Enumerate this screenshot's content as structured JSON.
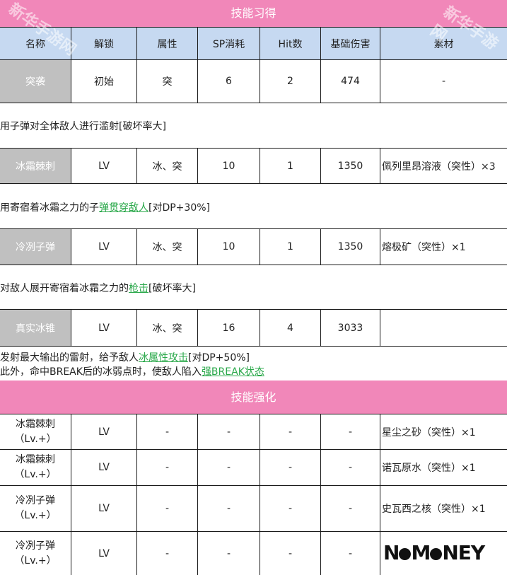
{
  "section1_title": "技能习得",
  "section2_title": "技能强化",
  "headers": [
    "名称",
    "解锁",
    "属性",
    "SP消耗",
    "Hit数",
    "基础伤害",
    "素材"
  ],
  "skills": [
    {
      "name": "突袭",
      "unlock": "初始",
      "attr": "突",
      "sp": "6",
      "hit": "2",
      "dmg": "474",
      "mat": "-"
    },
    {
      "name": "冰霜棘刺",
      "unlock": "LV",
      "attr": "冰、突",
      "sp": "10",
      "hit": "1",
      "dmg": "1350",
      "mat": "佩列里昂溶液（突性）×3"
    },
    {
      "name": "冷冽子弹",
      "unlock": "LV",
      "attr": "冰、突",
      "sp": "10",
      "hit": "1",
      "dmg": "1350",
      "mat": "熔极矿（突性）×1"
    },
    {
      "name": "真实冰锥",
      "unlock": "LV",
      "attr": "冰、突",
      "sp": "16",
      "hit": "4",
      "dmg": "3033",
      "mat": ""
    }
  ],
  "descriptions": {
    "d1": "用子弹对全体敌人进行滥射[破坏率大]",
    "d2_pre": "用寄宿着冰霜之力的子",
    "d2_link": "弹贯穿敌人",
    "d2_post": "[对DP+30%]",
    "d3_pre": "对敌人展开寄宿着冰霜之力的",
    "d3_link": "枪击",
    "d3_post": "[破坏率大]",
    "d4a_pre": "发射最大输出的雷射，给予敌人",
    "d4a_link": "冰属性攻击",
    "d4a_post": "[对DP+50%]",
    "d4b_pre": "此外，命中BREAK后的冰弱点时，使敌人陷入",
    "d4b_link": "强BREAK状态"
  },
  "upgrades": [
    {
      "name": "冰霜棘刺",
      "lv": "（Lv.+）",
      "unlock": "LV",
      "a": "-",
      "b": "-",
      "c": "-",
      "d": "-",
      "mat": "星尘之砂（突性）×1"
    },
    {
      "name": "冰霜棘刺",
      "lv": "（Lv.+）",
      "unlock": "LV",
      "a": "-",
      "b": "-",
      "c": "-",
      "d": "-",
      "mat": "诺瓦原水（突性）×1"
    },
    {
      "name": "冷冽子弹",
      "lv": "（Lv.+）",
      "unlock": "LV",
      "a": "-",
      "b": "-",
      "c": "-",
      "d": "-",
      "mat": "史瓦西之核（突性）×1"
    },
    {
      "name": "冷冽子弹",
      "lv": "（Lv.+）",
      "unlock": "LV",
      "a": "-",
      "b": "-",
      "c": "-",
      "d": "-",
      "mat": ""
    }
  ],
  "watermark": "新华手游网",
  "logo": {
    "left": "N",
    "mid": "M",
    "right": "NEY"
  },
  "colors": {
    "band": "#f187b9",
    "header": "#c6d9f1",
    "gray_cell": "#c0c0c0",
    "link": "#2aa84a"
  }
}
